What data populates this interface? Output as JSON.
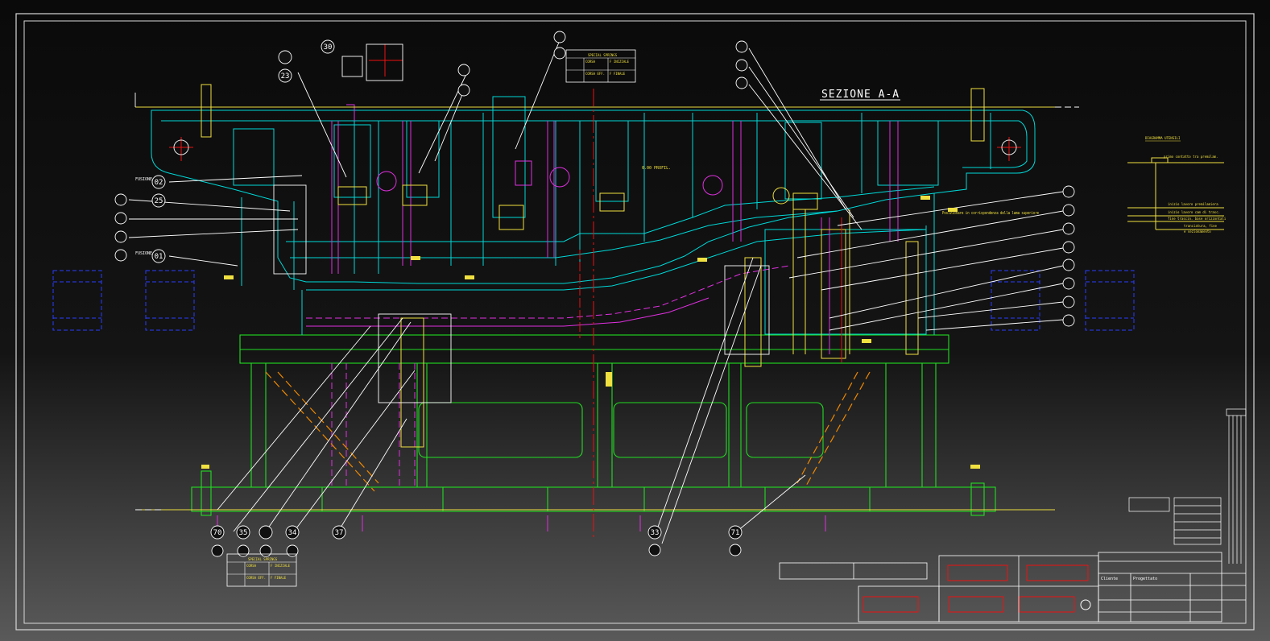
{
  "drawing": {
    "section_title": "SEZIONE A-A",
    "balloons_top": [
      "30",
      "23",
      "02",
      "25",
      "01"
    ],
    "balloons_bottom": [
      "70",
      "35",
      "34",
      "37",
      "33",
      "71"
    ],
    "side_labels": [
      "FUSIONE",
      "FUSIONE"
    ],
    "note_profile": "0.00 PROFIL.",
    "note_centre": "Posizionare in corrispondenza della lama superiore",
    "spring_note_top": [
      "SPECIAL SPRINGS",
      "CORSA",
      "F INIZIALE",
      "CORSA EFF.",
      "F FINALE"
    ],
    "spring_note_bottom": [
      "SPECIAL SPRINGS",
      "CORSA",
      "F INIZIALE",
      "CORSA EFF.",
      "F FINALE"
    ],
    "diagram_title": "DIAGRAMMA UTENSILI",
    "diagram_lines": [
      "primo contatto tra premilam.",
      "inizio lavoro premilamiera",
      "inizio lavoro cam di trasc.",
      "fine trascin. base orizzontali",
      "tranciatura, fine",
      "e sezionamento"
    ],
    "title_block": [
      "Cliente",
      "Progettato"
    ]
  },
  "colors": {
    "frame": "#e6e6e6",
    "green": "#22dd22",
    "cyan": "#00d8d8",
    "magenta": "#e030e0",
    "yellow": "#f0e040",
    "red": "#ee1111",
    "white": "#ffffff",
    "blue": "#2a3cff",
    "orange": "#ee8800"
  }
}
